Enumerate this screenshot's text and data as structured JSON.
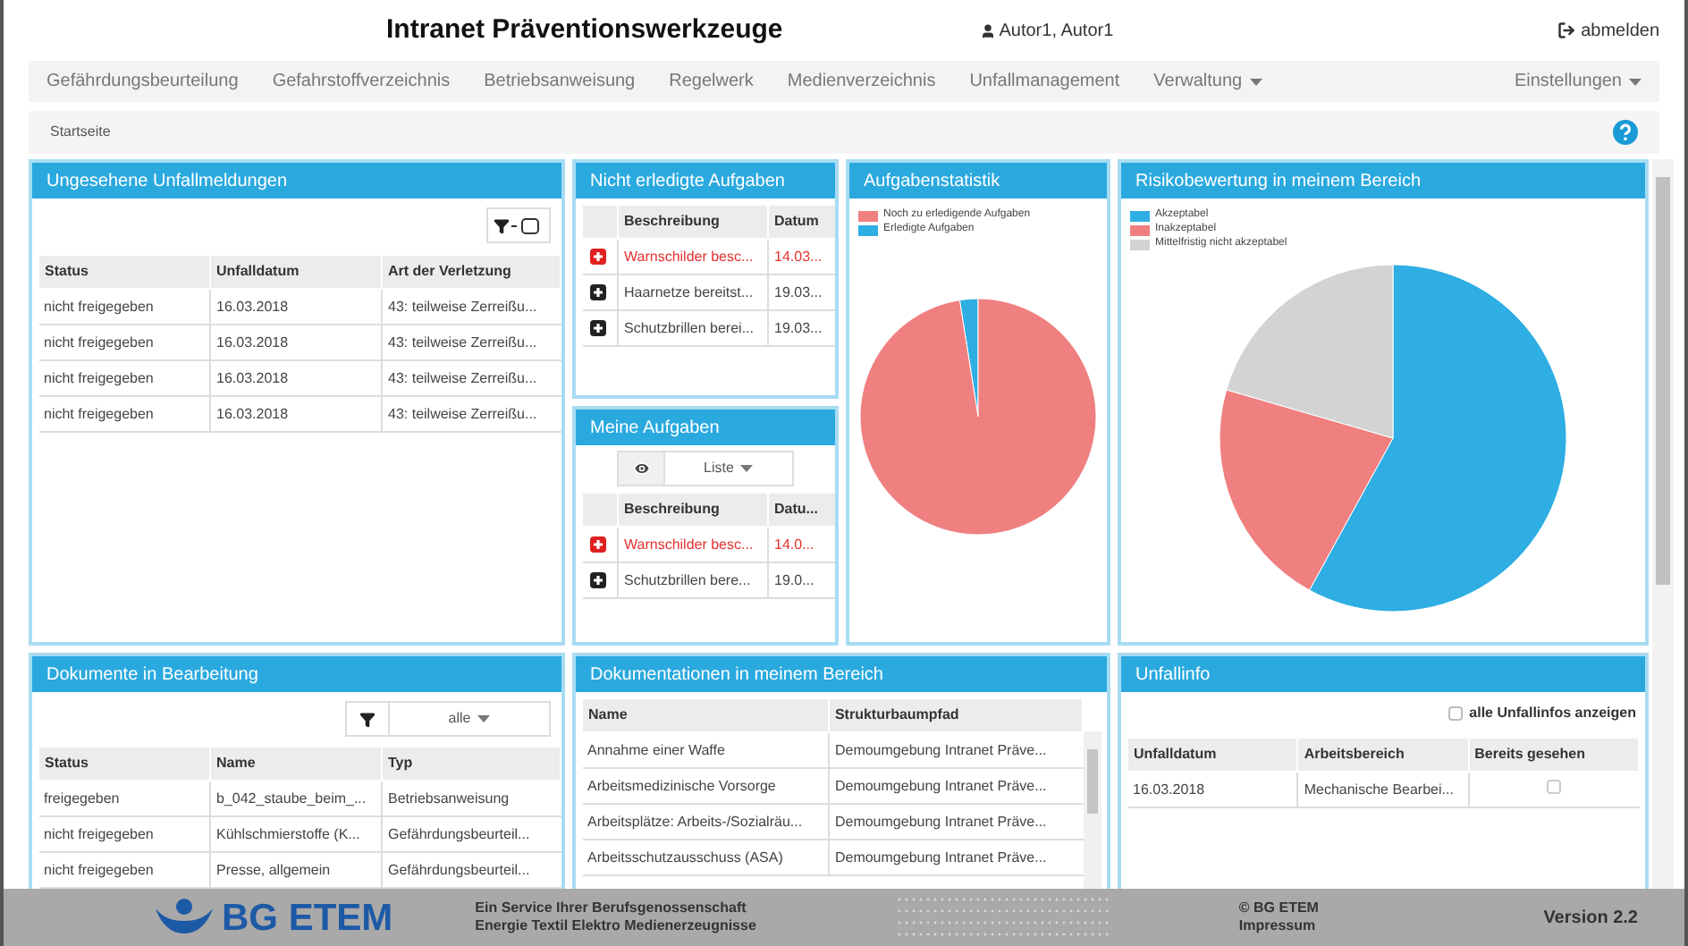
{
  "header": {
    "title": "Intranet Präventionswerkzeuge",
    "user": "Autor1, Autor1",
    "logout": "abmelden"
  },
  "nav": [
    {
      "label": "Gefährdungsbeurteilung",
      "dropdown": false
    },
    {
      "label": "Gefahrstoffverzeichnis",
      "dropdown": false
    },
    {
      "label": "Betriebsanweisung",
      "dropdown": false
    },
    {
      "label": "Regelwerk",
      "dropdown": false
    },
    {
      "label": "Medienverzeichnis",
      "dropdown": false
    },
    {
      "label": "Unfallmanagement",
      "dropdown": false
    },
    {
      "label": "Verwaltung",
      "dropdown": true
    }
  ],
  "nav_right": {
    "label": "Einstellungen",
    "dropdown": true
  },
  "breadcrumb": "Startseite",
  "unfallmeldungen": {
    "title": "Ungesehene Unfallmeldungen",
    "columns": [
      "Status",
      "Unfalldatum",
      "Art der Verletzung"
    ],
    "rows": [
      [
        "nicht freigegeben",
        "16.03.2018",
        "43: teilweise Zerreißu..."
      ],
      [
        "nicht freigegeben",
        "16.03.2018",
        "43: teilweise Zerreißu..."
      ],
      [
        "nicht freigegeben",
        "16.03.2018",
        "43: teilweise Zerreißu..."
      ],
      [
        "nicht freigegeben",
        "16.03.2018",
        "43: teilweise Zerreißu..."
      ]
    ]
  },
  "nicht_erledigt": {
    "title": "Nicht erledigte Aufgaben",
    "columns": [
      "Beschreibung",
      "Datum"
    ],
    "rows": [
      {
        "cells": [
          "Warnschilder besc...",
          "14.03..."
        ],
        "overdue": true
      },
      {
        "cells": [
          "Haarnetze bereitst...",
          "19.03..."
        ],
        "overdue": false
      },
      {
        "cells": [
          "Schutzbrillen berei...",
          "19.03..."
        ],
        "overdue": false
      }
    ]
  },
  "meine_aufgaben": {
    "title": "Meine Aufgaben",
    "view": "Liste",
    "columns": [
      "Beschreibung",
      "Datu..."
    ],
    "rows": [
      {
        "cells": [
          "Warnschilder besc...",
          "14.0..."
        ],
        "overdue": true
      },
      {
        "cells": [
          "Schutzbrillen bere...",
          "19.0..."
        ],
        "overdue": false
      }
    ]
  },
  "aufgabenstatistik": {
    "title": "Aufgabenstatistik",
    "legend": [
      {
        "label": "Noch zu erledigende Aufgaben",
        "color": "#f08080"
      },
      {
        "label": "Erledigte Aufgaben",
        "color": "#2eaee3"
      }
    ]
  },
  "risikobewertung": {
    "title": "Risikobewertung in meinem Bereich",
    "legend": [
      {
        "label": "Akzeptabel",
        "color": "#2eaee3"
      },
      {
        "label": "Inakzeptabel",
        "color": "#f08080"
      },
      {
        "label": "Mittelfristig nicht akzeptabel",
        "color": "#d3d3d3"
      }
    ]
  },
  "dokumente": {
    "title": "Dokumente in Bearbeitung",
    "filter": "alle",
    "columns": [
      "Status",
      "Name",
      "Typ"
    ],
    "rows": [
      [
        "freigegeben",
        "b_042_staube_beim_...",
        "Betriebsanweisung"
      ],
      [
        "nicht freigegeben",
        "Kühlschmierstoffe (K...",
        "Gefährdungsbeurteil..."
      ],
      [
        "nicht freigegeben",
        "Presse, allgemein",
        "Gefährdungsbeurteil..."
      ]
    ]
  },
  "dokumentationen": {
    "title": "Dokumentationen in meinem Bereich",
    "columns": [
      "Name",
      "Strukturbaumpfad"
    ],
    "rows": [
      [
        "Annahme einer Waffe",
        "Demoumgebung Intranet Präve..."
      ],
      [
        "Arbeitsmedizinische Vorsorge",
        "Demoumgebung Intranet Präve..."
      ],
      [
        "Arbeitsplätze: Arbeits-/Sozialräu...",
        "Demoumgebung Intranet Präve..."
      ],
      [
        "Arbeitsschutzausschuss (ASA)",
        "Demoumgebung Intranet Präve..."
      ]
    ]
  },
  "unfallinfo": {
    "title": "Unfallinfo",
    "show_all": {
      "label": "alle Unfallinfos anzeigen",
      "checked": false
    },
    "columns": [
      "Unfalldatum",
      "Arbeitsbereich",
      "Bereits gesehen"
    ],
    "rows": [
      {
        "cells": [
          "16.03.2018",
          "Mechanische Bearbei..."
        ],
        "seen": false
      }
    ]
  },
  "footer": {
    "logo": "BG ETEM",
    "tagline": [
      "Ein Service Ihrer Berufsgenossenschaft",
      "Energie Textil Elektro Medienerzeugnisse"
    ],
    "copyright": "© BG ETEM",
    "impressum": "Impressum",
    "version": "Version 2.2"
  }
}
